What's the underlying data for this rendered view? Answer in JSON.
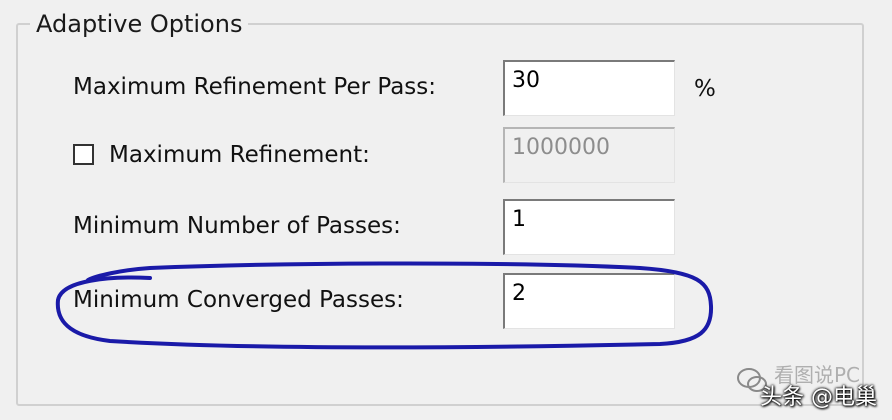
{
  "group": {
    "title": "Adaptive Options"
  },
  "fields": {
    "max_refinement_per_pass": {
      "label": "Maximum Refinement Per Pass:",
      "value": "30",
      "unit": "%"
    },
    "max_refinement": {
      "label": "Maximum Refinement:",
      "value": "1000000",
      "checked": false,
      "enabled": false
    },
    "min_number_of_passes": {
      "label": "Minimum Number of Passes:",
      "value": "1"
    },
    "min_converged_passes": {
      "label": "Minimum Converged Passes:",
      "value": "2"
    }
  },
  "annotation": {
    "highlight_color": "#1a1aa8"
  },
  "watermark": {
    "line1": "看图说PC",
    "line2": "头条 @电巢"
  },
  "colors": {
    "background": "#f0f0f0",
    "disabled_text": "#8d8d8d"
  }
}
